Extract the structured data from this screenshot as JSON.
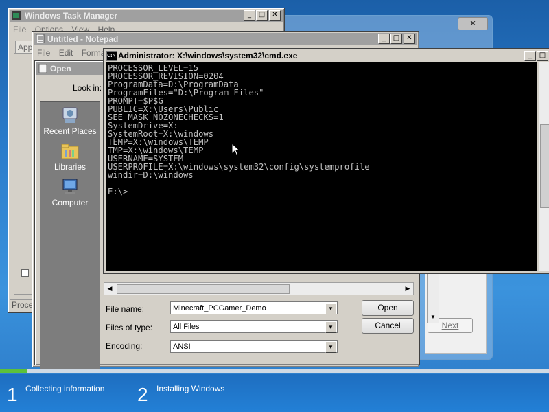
{
  "task_manager": {
    "title": "Windows Task Manager",
    "menu": [
      "File",
      "Options",
      "View",
      "Help"
    ],
    "tab_partial": "App",
    "status_partial": "Proces"
  },
  "notepad": {
    "title": "Untitled - Notepad",
    "menu": [
      "File",
      "Edit",
      "Format"
    ]
  },
  "open_dialog": {
    "title": "Open",
    "look_in_label": "Look in:",
    "places": [
      "Recent Places",
      "Libraries",
      "Computer"
    ],
    "file_name_label": "File name:",
    "file_name_value": "Minecraft_PCGamer_Demo",
    "files_of_type_label": "Files of type:",
    "files_of_type_value": "All Files",
    "encoding_label": "Encoding:",
    "encoding_value": "ANSI",
    "open_button": "Open",
    "cancel_button": "Cancel"
  },
  "cmd": {
    "title": "Administrator: X:\\windows\\system32\\cmd.exe",
    "icon_text": "C:\\",
    "lines": [
      "PROCESSOR_LEVEL=15",
      "PROCESSOR_REVISION=0204",
      "ProgramData=D:\\ProgramData",
      "ProgramFiles=\"D:\\Program Files\"",
      "PROMPT=$P$G",
      "PUBLIC=X:\\Users\\Public",
      "SEE_MASK_NOZONECHECKS=1",
      "SystemDrive=X:",
      "SystemRoot=X:\\windows",
      "TEMP=X:\\windows\\TEMP",
      "TMP=X:\\windows\\TEMP",
      "USERNAME=SYSTEM",
      "USERPROFILE=X:\\windows\\system32\\config\\systemprofile",
      "windir=D:\\windows",
      "",
      "E:\\>"
    ]
  },
  "setup": {
    "next_button": "Next",
    "steps": [
      {
        "num": "1",
        "label": "Collecting information"
      },
      {
        "num": "2",
        "label": "Installing Windows"
      }
    ],
    "progress": 0.05
  }
}
